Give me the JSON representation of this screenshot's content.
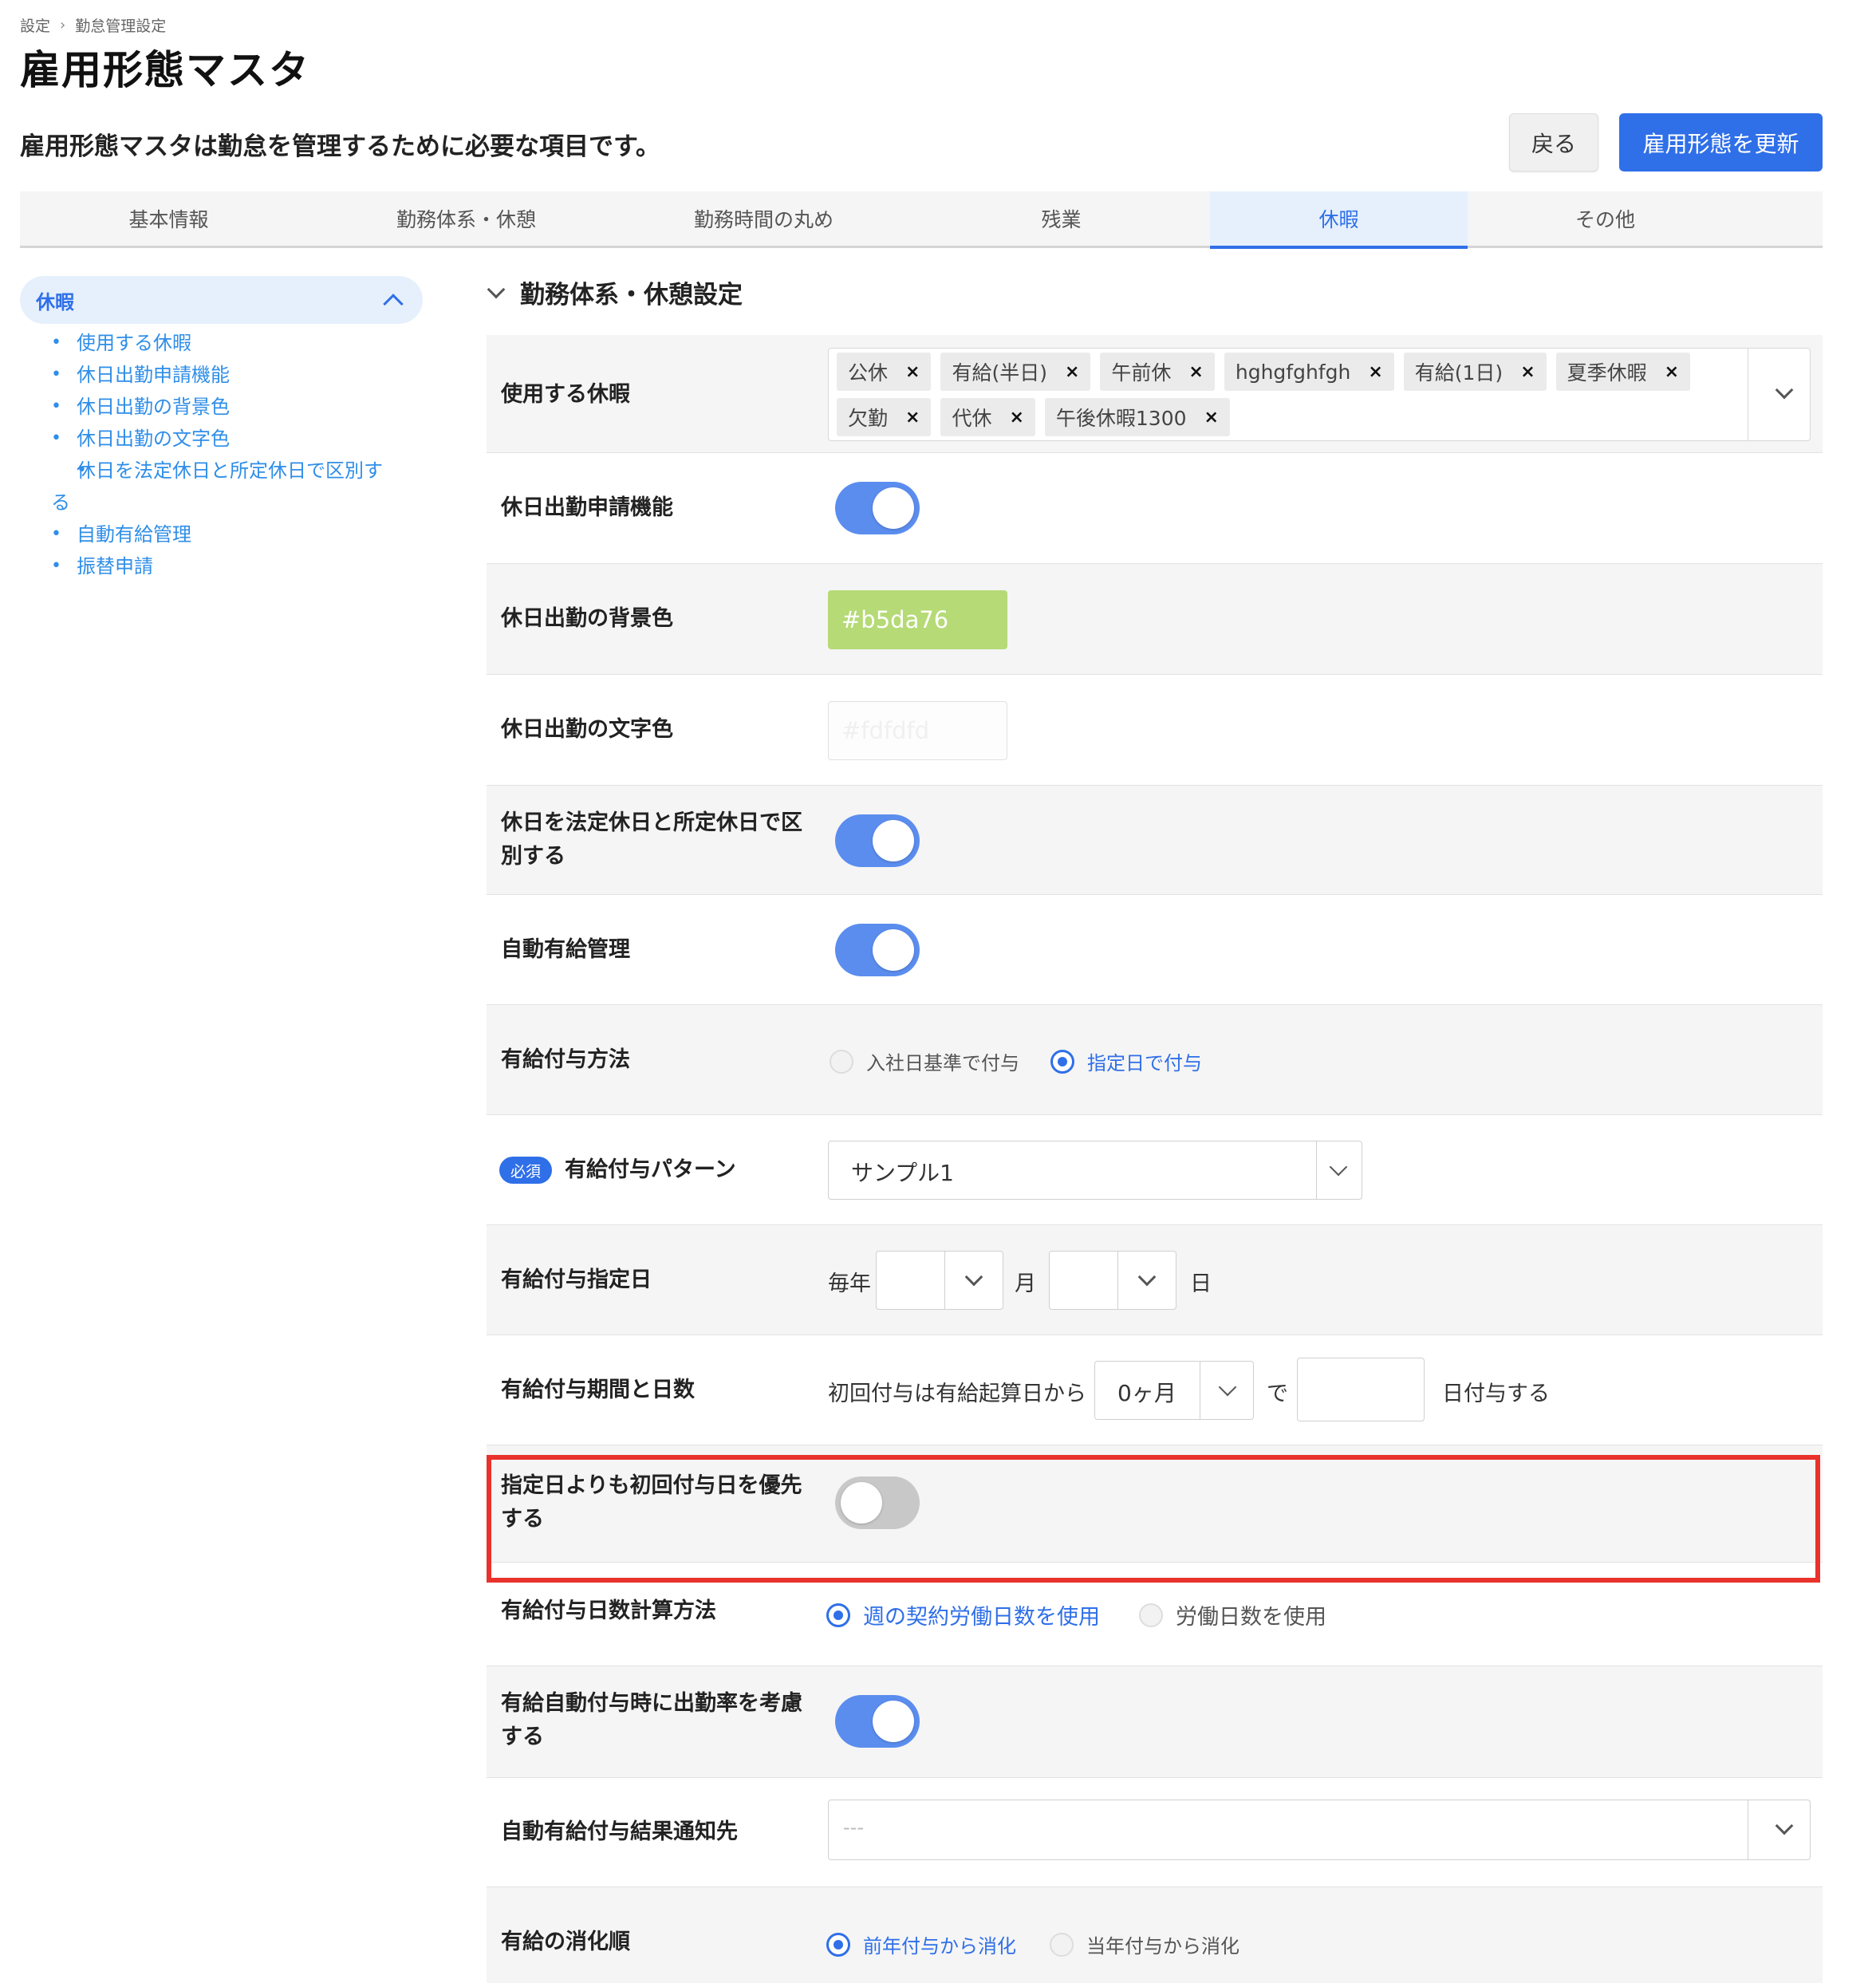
{
  "breadcrumb": {
    "items": [
      "設定",
      "勤怠管理設定"
    ],
    "separator": "›"
  },
  "page": {
    "title": "雇用形態マスタ",
    "description": "雇用形態マスタは勤怠を管理するために必要な項目です。"
  },
  "actions": {
    "back_label": "戻る",
    "update_label": "雇用形態を更新"
  },
  "tabs": [
    "基本情報",
    "勤務体系・休憩",
    "勤務時間の丸め",
    "残業",
    "休暇",
    "その他"
  ],
  "active_tab": "休暇",
  "sidebar": {
    "header": "休暇",
    "items": [
      "使用する休暇",
      "休日出勤申請機能",
      "休日出勤の背景色",
      "休日出勤の文字色",
      "休日を法定休日と所定休日で区別する",
      "自動有給管理",
      "振替申請"
    ]
  },
  "section": {
    "title": "勤務体系・休憩設定"
  },
  "rows": {
    "leave_types": {
      "label": "使用する休暇",
      "tags": [
        "公休",
        "有給(半日)",
        "午前休",
        "hghgfghfgh",
        "有給(1日)",
        "夏季休暇",
        "欠勤",
        "代休",
        "午後休暇1300"
      ],
      "remove_icon": "×"
    },
    "holiday_request": {
      "label": "休日出勤申請機能",
      "enabled": true
    },
    "holiday_bg": {
      "label": "休日出勤の背景色",
      "value": "#b5da76"
    },
    "holiday_text": {
      "label": "休日出勤の文字色",
      "value": "#fdfdfd"
    },
    "distinguish": {
      "label_line1": "休日を法定休日と所定休日で区",
      "label_line2": "別する",
      "enabled": true
    },
    "auto_paid": {
      "label": "自動有給管理",
      "enabled": true
    },
    "grant_method": {
      "label": "有給付与方法",
      "options": [
        "入社日基準で付与",
        "指定日で付与"
      ],
      "selected": "指定日で付与"
    },
    "grant_pattern": {
      "label": "有給付与パターン",
      "required_badge": "必須",
      "value": "サンプル1"
    },
    "grant_date": {
      "label": "有給付与指定日",
      "prefix": "毎年",
      "month_unit": "月",
      "day_unit": "日"
    },
    "grant_period": {
      "label": "有給付与期間と日数",
      "prefix": "初回付与は有給起算日から",
      "period_value": "0ヶ月",
      "connector": "で",
      "suffix": "日付与する"
    },
    "prioritize_first": {
      "label_line1": "指定日よりも初回付与日を優先",
      "label_line2": "する",
      "enabled": false
    },
    "grant_days_calc": {
      "label": "有給付与日数計算方法",
      "options": [
        "週の契約労働日数を使用",
        "労働日数を使用"
      ],
      "selected": "週の契約労働日数を使用"
    },
    "attendance_rate": {
      "label_line1": "有給自動付与時に出勤率を考慮",
      "label_line2": "する",
      "enabled": true
    },
    "notify_target": {
      "label": "自動有給付与結果通知先",
      "placeholder": "---"
    },
    "consumption_order": {
      "label": "有給の消化順",
      "options": [
        "前年付与から消化",
        "当年付与から消化"
      ],
      "selected": "前年付与から消化"
    }
  },
  "colors": {
    "accent": "#2f6fe8",
    "toggle_on": "#5b8def",
    "highlight": "#e8322b"
  }
}
